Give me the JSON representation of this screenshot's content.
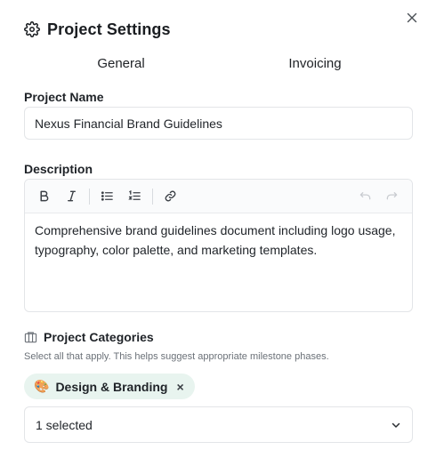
{
  "dialog": {
    "title": "Project Settings",
    "icon": "gear-icon",
    "close_icon": "close-icon"
  },
  "tabs": [
    {
      "label": "General"
    },
    {
      "label": "Invoicing"
    }
  ],
  "project_name": {
    "label": "Project Name",
    "value": "Nexus Financial Brand Guidelines"
  },
  "description": {
    "label": "Description",
    "toolbar": [
      "bold-icon",
      "italic-icon",
      "bullet-list-icon",
      "numbered-list-icon",
      "link-icon",
      "undo-icon",
      "redo-icon"
    ],
    "text": "Comprehensive brand guidelines document including logo usage, typography, color palette, and marketing templates."
  },
  "categories": {
    "label": "Project Categories",
    "icon": "columns-icon",
    "helper": "Select all that apply. This helps suggest appropriate milestone phases.",
    "selected_chip": {
      "emoji": "🎨",
      "label": "Design & Branding",
      "remove": "×"
    },
    "select_value": "1 selected"
  },
  "colors": {
    "chip_bg": "#e8f4ef",
    "border": "#e3e5e8",
    "text": "#1f2328"
  }
}
